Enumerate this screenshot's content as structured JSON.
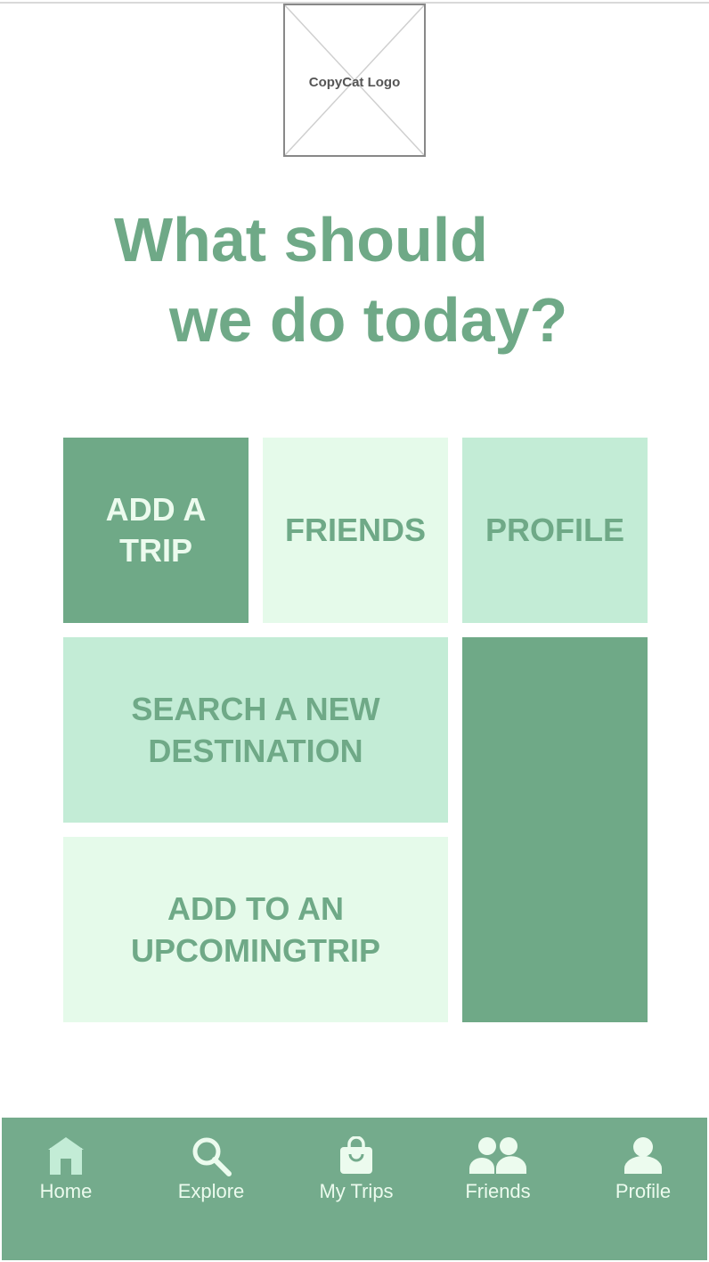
{
  "logo": {
    "label": "CopyCat Logo"
  },
  "heading": {
    "line1": "What should",
    "line2": "we do today?"
  },
  "tiles": {
    "add_trip": {
      "line1": "ADD A",
      "line2": "TRIP"
    },
    "friends": {
      "label": "FRIENDS"
    },
    "profile": {
      "label": "PROFILE"
    },
    "search": {
      "line1": "SEARCH A NEW",
      "line2": "DESTINATION"
    },
    "upcoming": {
      "line1": "ADD TO AN",
      "line2": "UPCOMINGTRIP"
    }
  },
  "nav": [
    {
      "label": "Home",
      "icon": "home-icon"
    },
    {
      "label": "Explore",
      "icon": "search-icon"
    },
    {
      "label": "My Trips",
      "icon": "shopping-bag-icon"
    },
    {
      "label": "Friends",
      "icon": "people-icon"
    },
    {
      "label": "Profile",
      "icon": "person-icon"
    }
  ],
  "colors": {
    "primary": "#6fa987",
    "pale": "#e5faea",
    "mint": "#c3ecd6",
    "navbar": "#74ab8c",
    "nav_text": "#ecfbee"
  }
}
